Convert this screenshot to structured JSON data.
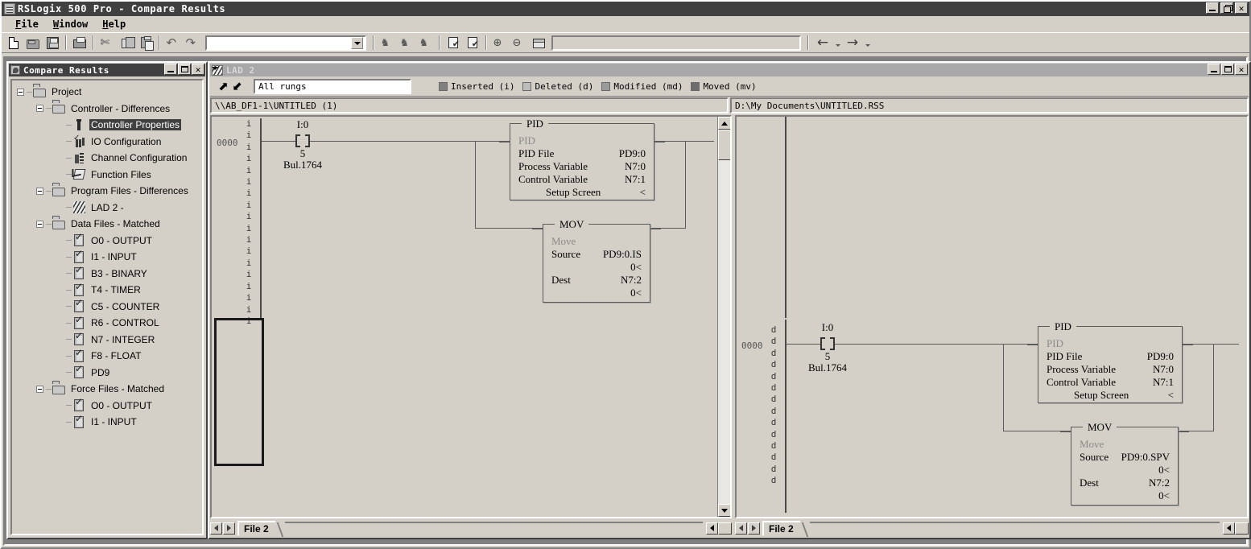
{
  "window": {
    "title": "RSLogix 500 Pro - Compare Results",
    "icon": "ladder-app-icon",
    "buttons": {
      "minimize": "_",
      "restore": "restore-icon",
      "close": "×"
    }
  },
  "menubar": {
    "items": [
      {
        "label": "File",
        "accel": "F"
      },
      {
        "label": "Window",
        "accel": "W"
      },
      {
        "label": "Help",
        "accel": "H"
      }
    ]
  },
  "toolbar": {
    "buttons": [
      {
        "name": "new-file-icon",
        "title": "New"
      },
      {
        "name": "open-folder-icon",
        "title": "Open"
      },
      {
        "name": "save-disk-icon",
        "title": "Save"
      },
      {
        "name": "print-icon",
        "title": "Print"
      },
      {
        "name": "cut-scissors-icon",
        "title": "Cut",
        "glyph": "✄"
      },
      {
        "name": "copy-icon",
        "title": "Copy"
      },
      {
        "name": "paste-icon",
        "title": "Paste"
      },
      {
        "name": "undo-arrow-icon",
        "title": "Undo",
        "glyph": "↶"
      },
      {
        "name": "redo-arrow-icon",
        "title": "Redo",
        "glyph": "↷"
      },
      {
        "name": "find-binoculars-icon",
        "title": "Find",
        "glyph": "♟"
      },
      {
        "name": "find-next-binoculars-icon",
        "title": "Find Next",
        "glyph": "♟"
      },
      {
        "name": "replace-icon",
        "title": "Replace",
        "glyph": "♟"
      },
      {
        "name": "compare-report-icon",
        "title": "Report"
      },
      {
        "name": "verify-report-icon",
        "title": "Verify"
      },
      {
        "name": "zoom-in-icon",
        "title": "Zoom In",
        "glyph": "⊕"
      },
      {
        "name": "zoom-out-icon",
        "title": "Zoom Out",
        "glyph": "⊖"
      },
      {
        "name": "window-rect-icon",
        "title": "Window"
      },
      {
        "name": "back-arrow-icon",
        "title": "Back",
        "glyph": "←"
      },
      {
        "name": "forward-arrow-icon",
        "title": "Forward",
        "glyph": "→"
      }
    ],
    "address_combo": {
      "value": "",
      "placeholder": ""
    },
    "wide_combo": {
      "value": ""
    }
  },
  "compare_panel": {
    "title": "Compare Results",
    "buttons": {
      "minimize": "_",
      "maximize": "maximize-icon",
      "close": "×"
    },
    "tree": [
      {
        "label": "Project",
        "depth": 0,
        "icon": "folder-icon",
        "expander": "minus",
        "selected": false
      },
      {
        "label": "Controller - Differences",
        "depth": 1,
        "icon": "folder-icon",
        "expander": "minus",
        "selected": false
      },
      {
        "label": "Controller Properties",
        "depth": 2,
        "icon": "controller-properties-icon",
        "expander": "none",
        "selected": true
      },
      {
        "label": "IO Configuration",
        "depth": 2,
        "icon": "io-configuration-icon",
        "expander": "none",
        "selected": false
      },
      {
        "label": "Channel Configuration",
        "depth": 2,
        "icon": "channel-configuration-icon",
        "expander": "none",
        "selected": false
      },
      {
        "label": "Function Files",
        "depth": 2,
        "icon": "function-files-icon",
        "expander": "none",
        "selected": false
      },
      {
        "label": "Program Files - Differences",
        "depth": 1,
        "icon": "folder-icon",
        "expander": "minus",
        "selected": false
      },
      {
        "label": "LAD 2 -",
        "depth": 2,
        "icon": "ladder-file-icon",
        "expander": "none",
        "selected": false
      },
      {
        "label": "Data Files - Matched",
        "depth": 1,
        "icon": "folder-icon",
        "expander": "minus",
        "selected": false
      },
      {
        "label": "O0 - OUTPUT",
        "depth": 2,
        "icon": "data-file-matched-icon",
        "expander": "none",
        "selected": false
      },
      {
        "label": "I1 - INPUT",
        "depth": 2,
        "icon": "data-file-matched-icon",
        "expander": "none",
        "selected": false
      },
      {
        "label": "B3 - BINARY",
        "depth": 2,
        "icon": "data-file-matched-icon",
        "expander": "none",
        "selected": false
      },
      {
        "label": "T4 - TIMER",
        "depth": 2,
        "icon": "data-file-matched-icon",
        "expander": "none",
        "selected": false
      },
      {
        "label": "C5 - COUNTER",
        "depth": 2,
        "icon": "data-file-matched-icon",
        "expander": "none",
        "selected": false
      },
      {
        "label": "R6 - CONTROL",
        "depth": 2,
        "icon": "data-file-matched-icon",
        "expander": "none",
        "selected": false
      },
      {
        "label": "N7 - INTEGER",
        "depth": 2,
        "icon": "data-file-matched-icon",
        "expander": "none",
        "selected": false
      },
      {
        "label": "F8 - FLOAT",
        "depth": 2,
        "icon": "data-file-matched-icon",
        "expander": "none",
        "selected": false
      },
      {
        "label": "PD9",
        "depth": 2,
        "icon": "data-file-matched-icon",
        "expander": "none",
        "selected": false
      },
      {
        "label": "Force Files - Matched",
        "depth": 1,
        "icon": "folder-icon",
        "expander": "minus",
        "selected": false
      },
      {
        "label": "O0 - OUTPUT",
        "depth": 2,
        "icon": "data-file-matched-icon",
        "expander": "none",
        "selected": false
      },
      {
        "label": "I1 - INPUT",
        "depth": 2,
        "icon": "data-file-matched-icon",
        "expander": "none",
        "selected": false
      }
    ]
  },
  "lad_window": {
    "title": "LAD 2",
    "buttons": {
      "minimize": "_",
      "maximize": "maximize-icon",
      "close": "×"
    },
    "toolbar": {
      "prev_diff_icon": "up-arrow-icon",
      "next_diff_icon": "down-arrow-icon",
      "rung_filter": {
        "value": "All rungs",
        "options": [
          "All rungs"
        ]
      }
    },
    "legend": [
      {
        "label": "Inserted (i)",
        "color": "#808080"
      },
      {
        "label": "Deleted (d)",
        "color": "#bcbcbc"
      },
      {
        "label": "Modified (md)",
        "color": "#9a9a9a"
      },
      {
        "label": "Moved (mv)",
        "color": "#6e6e6e"
      }
    ],
    "left_pane": {
      "path": "\\\\AB_DF1-1\\UNTITLED (1)",
      "rung_number": "0000",
      "change_marks": [
        "i",
        "i",
        "i",
        "i",
        "i",
        "i",
        "i",
        "i",
        "i",
        "i",
        "i",
        "i",
        "i",
        "i",
        "i",
        "i",
        "i",
        "i"
      ],
      "contact": {
        "address": "I:0",
        "bit": "5",
        "module": "Bul.1764"
      },
      "pid_block": {
        "title": "PID",
        "subtitle": "PID",
        "rows": [
          {
            "key": "PID File",
            "value": "PD9:0"
          },
          {
            "key": "Process Variable",
            "value": "N7:0"
          },
          {
            "key": "Control Variable",
            "value": "N7:1"
          }
        ],
        "setup": "Setup Screen",
        "setup_marker": "<"
      },
      "mov_block": {
        "title": "MOV",
        "subtitle": "Move",
        "rows": [
          {
            "key": "Source",
            "value": "PD9:0.IS",
            "value2": "0<"
          },
          {
            "key": "Dest",
            "value": "N7:2",
            "value2": "0<"
          }
        ]
      },
      "tab": {
        "label": "File 2",
        "prev": "◀",
        "next": "▶"
      }
    },
    "right_pane": {
      "path": "D:\\My Documents\\UNTITLED.RSS",
      "rung_number": "0000",
      "change_marks": [
        "d",
        "d",
        "d",
        "d",
        "d",
        "d",
        "d",
        "d",
        "d",
        "d",
        "d",
        "d",
        "d",
        "d"
      ],
      "contact": {
        "address": "I:0",
        "bit": "5",
        "module": "Bul.1764"
      },
      "pid_block": {
        "title": "PID",
        "subtitle": "PID",
        "rows": [
          {
            "key": "PID File",
            "value": "PD9:0"
          },
          {
            "key": "Process Variable",
            "value": "N7:0"
          },
          {
            "key": "Control Variable",
            "value": "N7:1"
          }
        ],
        "setup": "Setup Screen",
        "setup_marker": "<"
      },
      "mov_block": {
        "title": "MOV",
        "subtitle": "Move",
        "rows": [
          {
            "key": "Source",
            "value": "PD9:0.SPV",
            "value2": "0<"
          },
          {
            "key": "Dest",
            "value": "N7:2",
            "value2": "0<"
          }
        ]
      },
      "tab": {
        "label": "File 2",
        "prev": "◀",
        "next": "▶"
      }
    }
  },
  "colors": {
    "window_bg": "#d4d0c8",
    "titlebar_active": "#404040",
    "titlebar_inactive": "#a8a8a8",
    "workspace_bg": "#808080",
    "selection": "#404040",
    "ladder_line": "#5a5a5a"
  }
}
